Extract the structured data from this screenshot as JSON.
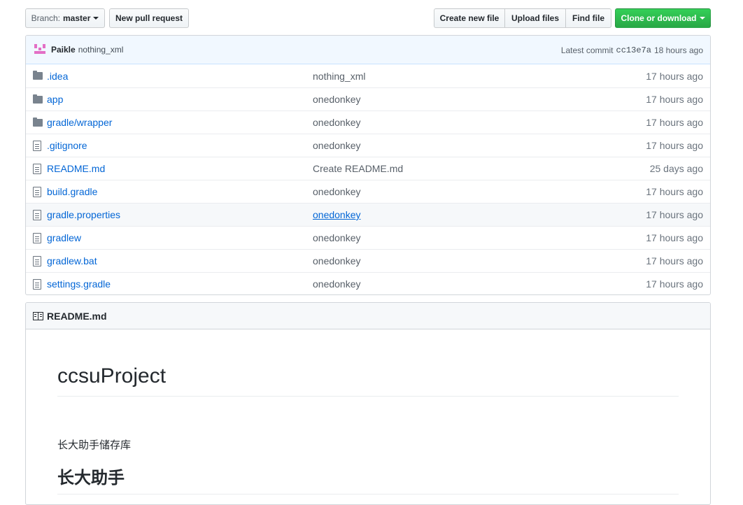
{
  "toolbar": {
    "branch_prefix": "Branch:",
    "branch_name": "master",
    "new_pull_request": "New pull request",
    "create_new_file": "Create new file",
    "upload_files": "Upload files",
    "find_file": "Find file",
    "clone_or_download": "Clone or download"
  },
  "commit": {
    "author": "Paikle",
    "message": "nothing_xml",
    "latest_commit_label": "Latest commit",
    "sha": "cc13e7a",
    "age": "18 hours ago"
  },
  "files": [
    {
      "type": "folder",
      "name": ".idea",
      "message": "nothing_xml",
      "age": "17 hours ago"
    },
    {
      "type": "folder",
      "name": "app",
      "message": "onedonkey",
      "age": "17 hours ago"
    },
    {
      "type": "folder",
      "name": "gradle/wrapper",
      "message": "onedonkey",
      "age": "17 hours ago"
    },
    {
      "type": "file",
      "name": ".gitignore",
      "message": "onedonkey",
      "age": "17 hours ago"
    },
    {
      "type": "file",
      "name": "README.md",
      "message": "Create README.md",
      "age": "25 days ago"
    },
    {
      "type": "file",
      "name": "build.gradle",
      "message": "onedonkey",
      "age": "17 hours ago"
    },
    {
      "type": "file",
      "name": "gradle.properties",
      "message": "onedonkey",
      "age": "17 hours ago"
    },
    {
      "type": "file",
      "name": "gradlew",
      "message": "onedonkey",
      "age": "17 hours ago"
    },
    {
      "type": "file",
      "name": "gradlew.bat",
      "message": "onedonkey",
      "age": "17 hours ago"
    },
    {
      "type": "file",
      "name": "settings.gradle",
      "message": "onedonkey",
      "age": "17 hours ago"
    }
  ],
  "readme": {
    "header": "README.md",
    "title": "ccsuProject",
    "description": "长大助手储存库",
    "subtitle": "长大助手"
  },
  "colors": {
    "link": "#0366d6",
    "primary_button": "#28a745",
    "commit_bar": "#f1f8ff",
    "avatar": "#e36fc6"
  }
}
